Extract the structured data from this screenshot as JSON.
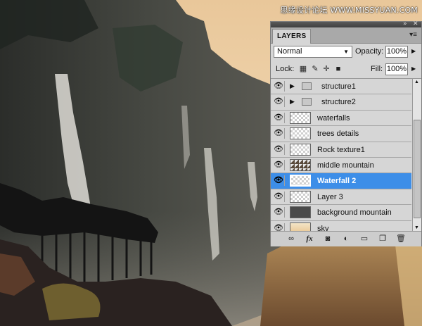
{
  "watermark": "思缘设计论坛 WWW.MISSYUAN.COM",
  "panel": {
    "collapse_icon": "double-arrow-right-icon",
    "close_icon": "close-icon",
    "tab_label": "LAYERS",
    "menu_icon": "panel-menu-icon",
    "blend_mode": "Normal",
    "opacity_label": "Opacity:",
    "opacity_value": "100%",
    "lock_label": "Lock:",
    "fill_label": "Fill:",
    "fill_value": "100%",
    "layers": [
      {
        "name": "structure1",
        "type": "group",
        "visible": true
      },
      {
        "name": "structure2",
        "type": "group",
        "visible": true
      },
      {
        "name": "waterfalls",
        "type": "layer",
        "visible": true
      },
      {
        "name": "trees details",
        "type": "layer",
        "visible": true
      },
      {
        "name": "Rock texture1",
        "type": "layer",
        "visible": true
      },
      {
        "name": "middle mountain",
        "type": "layer",
        "visible": true
      },
      {
        "name": "Waterfall 2",
        "type": "layer",
        "visible": true,
        "selected": true
      },
      {
        "name": "Layer 3",
        "type": "layer",
        "visible": true
      },
      {
        "name": "background mountain",
        "type": "layer",
        "visible": true
      },
      {
        "name": "sky",
        "type": "layer",
        "visible": true
      }
    ],
    "footer_icons": [
      "link-layers-icon",
      "fx-icon",
      "layer-mask-icon",
      "adjustment-layer-icon",
      "new-group-icon",
      "new-layer-icon",
      "trash-icon"
    ]
  },
  "colors": {
    "selected_row": "#3d8ee8",
    "panel_bg": "#d6d6d6"
  }
}
